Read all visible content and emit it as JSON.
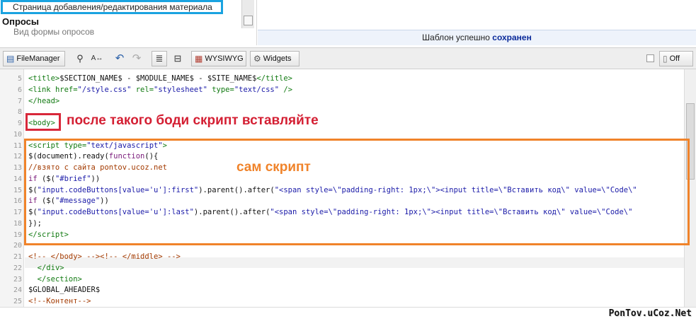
{
  "sidebar": {
    "selected_item": "Страница добавления/редактирования материала",
    "section_title": "Опросы",
    "section_sub": "Вид формы опросов"
  },
  "status": {
    "prefix": "Шаблон успешно",
    "emphasis": "сохранен"
  },
  "toolbar": {
    "filemanager_label": "FileManager",
    "wysiwyg_label": "WYSIWYG",
    "widgets_label": "Widgets",
    "off_label": "Off"
  },
  "editor": {
    "lines": [
      {
        "n": "5",
        "html": "<span class='tag'>&lt;title&gt;</span>$SECTION_NAME$ - $MODULE_NAME$ - $SITE_NAME$<span class='tag'>&lt;/title&gt;</span>"
      },
      {
        "n": "6",
        "html": "<span class='tag'>&lt;link</span> <span class='tag'>href=</span><span class='str'>\"/style.css\"</span> <span class='tag'>rel=</span><span class='str'>\"stylesheet\"</span> <span class='tag'>type=</span><span class='str'>\"text/css\"</span> <span class='tag'>/&gt;</span>"
      },
      {
        "n": "7",
        "html": "<span class='tag'>&lt;/head&gt;</span>"
      },
      {
        "n": "8",
        "html": ""
      },
      {
        "n": "9",
        "html": "<span class='tag'>&lt;body&gt;</span>"
      },
      {
        "n": "10",
        "html": ""
      },
      {
        "n": "11",
        "html": "<span class='tag'>&lt;script</span> <span class='tag'>type=</span><span class='str'>\"text/javascript\"</span><span class='tag'>&gt;</span>"
      },
      {
        "n": "12",
        "html": "$(document).ready(<span class='kw'>function</span>(){"
      },
      {
        "n": "13",
        "html": "<span class='cmt'>//взято с сайта pontov.ucoz.net</span>"
      },
      {
        "n": "14",
        "html": "<span class='kw'>if</span> ($(<span class='str'>\"#brief\"</span>))"
      },
      {
        "n": "15",
        "html": "$(<span class='str'>\"input.codeButtons[value='u']:first\"</span>).parent().after(<span class='str'>\"&lt;span style=\\\"padding-right: 1px;\\\"&gt;&lt;input title=\\\"Вставить код\\\" value=\\\"Code\\\"</span>"
      },
      {
        "n": "16",
        "html": "<span class='kw'>if</span> ($(<span class='str'>\"#message\"</span>))"
      },
      {
        "n": "17",
        "html": "$(<span class='str'>\"input.codeButtons[value='u']:last\"</span>).parent().after(<span class='str'>\"&lt;span style=\\\"padding-right: 1px;\\\"&gt;&lt;input title=\\\"Вставить код\\\" value=\\\"Code\\\"</span>"
      },
      {
        "n": "18",
        "html": "});"
      },
      {
        "n": "19",
        "html": "<span class='tag'>&lt;/script&gt;</span>"
      },
      {
        "n": "20",
        "html": ""
      },
      {
        "n": "21",
        "html": "<span class='cmt'>&lt;!-- &lt;/body&gt; --&gt;&lt;!-- &lt;/middle&gt; --&gt;</span>"
      },
      {
        "n": "22",
        "html": "  <span class='tag'>&lt;/div&gt;</span>"
      },
      {
        "n": "23",
        "html": "  <span class='tag'>&lt;/section&gt;</span>"
      },
      {
        "n": "24",
        "html": "$GLOBAL_AHEADER$"
      },
      {
        "n": "25",
        "html": "<span class='cmt'>&lt;!--Контент--&gt;</span>"
      }
    ]
  },
  "annotations": {
    "body_note": "после такого боди скрипт вставляйте",
    "script_note": "сам скрипт"
  },
  "watermark": "PonTov.uCoz.Net",
  "colors": {
    "selection_border": "#1aa3e0",
    "body_note": "#d41f33",
    "script_note": "#f0832a"
  }
}
